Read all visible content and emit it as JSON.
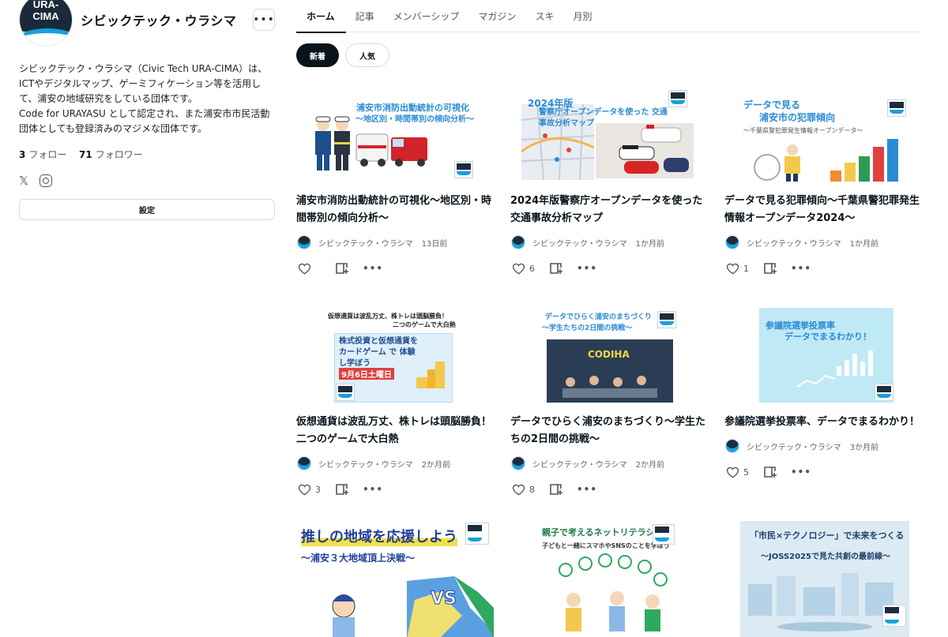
{
  "sidebar": {
    "logo_text": "URA-\nCIMA",
    "creator_name": "シビックテック・ウラシマ",
    "bio": [
      "シビックテック・ウラシマ（Civic Tech URA-CIMA）は、ICTやデジタルマップ、ゲーミフィケーション等を活用して、浦安の地域研究をしている団体です。",
      "Code for URAYASU として認定され、また浦安市市民活動団体としても登録済みのマジメな団体です。"
    ],
    "follow_count": "3",
    "follow_label": "フォロー",
    "follower_count": "71",
    "follower_label": "フォロワー",
    "settings_label": "設定"
  },
  "tabs": [
    {
      "label": "ホーム",
      "active": true
    },
    {
      "label": "記事",
      "active": false
    },
    {
      "label": "メンバーシップ",
      "active": false
    },
    {
      "label": "マガジン",
      "active": false
    },
    {
      "label": "スキ",
      "active": false
    },
    {
      "label": "月別",
      "active": false
    }
  ],
  "filters": {
    "new": "新着",
    "popular": "人気"
  },
  "cards": [
    {
      "thumb_line1": "浦安市消防出動統計の可視化",
      "thumb_line2": "〜地区別・時間帯別の傾向分析〜",
      "title": "浦安市消防出動統計の可視化〜地区別・時間帯別の傾向分析〜",
      "author": "シビックテック・ウラシマ",
      "date": "13日前",
      "likes": ""
    },
    {
      "thumb_line1": "2024年版",
      "thumb_line2": "警察庁オープンデータを使った 交通事故分析マップ",
      "title": "2024年版警察庁オープンデータを使った交通事故分析マップ",
      "author": "シビックテック・ウラシマ",
      "date": "1か月前",
      "likes": "6"
    },
    {
      "thumb_line1": "データで見る",
      "thumb_line2": "浦安市の犯罪傾向",
      "thumb_line3": "〜千葉県警犯罪発生情報オープンデータ〜",
      "title": "データで見る犯罪傾向〜千葉県警犯罪発生情報オープンデータ2024〜",
      "author": "シビックテック・ウラシマ",
      "date": "1か月前",
      "likes": "1"
    },
    {
      "thumb_line1": "仮想通貨は波乱万丈、株トレは頭脳勝負！",
      "thumb_line2": "二つのゲームで大白熱",
      "thumb_line3": "株式投資と仮想通貨を カードゲーム で 体験し学ぼう",
      "thumb_line4": "9月6日土曜日",
      "title": "仮想通貨は波乱万丈、株トレは頭脳勝負！二つのゲームで大白熱",
      "author": "シビックテック・ウラシマ",
      "date": "2か月前",
      "likes": "3"
    },
    {
      "thumb_line1": "データでひらく浦安のまちづくり",
      "thumb_line2": "〜学生たちの2日間の挑戦〜",
      "thumb_line3": "CODIHA",
      "title": "データでひらく浦安のまちづくり〜学生たちの2日間の挑戦〜",
      "author": "シビックテック・ウラシマ",
      "date": "2か月前",
      "likes": "8"
    },
    {
      "thumb_line1": "参議院選挙投票率",
      "thumb_line2": "データでまるわかり！",
      "title": "参議院選挙投票率、データでまるわかり！",
      "author": "シビックテック・ウラシマ",
      "date": "3か月前",
      "likes": "5"
    },
    {
      "thumb_line1": "推しの地域を応援しよう",
      "thumb_line2": "〜浦安３大地域頂上決戦〜",
      "thumb_line3": "VS"
    },
    {
      "thumb_line1": "親子で考えるネットリテラシー",
      "thumb_line2": "子どもと一緒にスマホやSNSのことを学ぼう"
    },
    {
      "thumb_line1": "「市民×テクノロジー」で未来をつくる",
      "thumb_line2": "〜JOSS2025で見た共創の最前線〜"
    }
  ],
  "colors": {
    "accent": "#08131a",
    "brand_blue": "#1aa0dc",
    "thumb_text": "#2a8bd4"
  }
}
